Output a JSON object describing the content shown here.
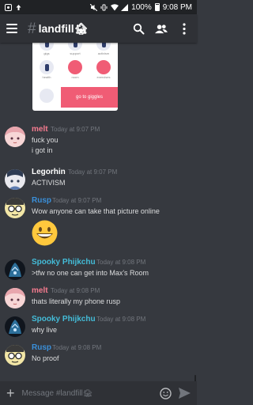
{
  "status_bar": {
    "battery": "100%",
    "time": "9:08 PM"
  },
  "header": {
    "hash": "#",
    "channel": "landfill",
    "channel_emoji": "🏚"
  },
  "attachment": {
    "labels": [
      "gigs",
      "support",
      "activism",
      "health",
      "room",
      "exercises"
    ],
    "button_label": "go to giggles"
  },
  "messages": [
    {
      "author": "melt",
      "color": "#f47b8f",
      "time": "Today at 9:07 PM",
      "lines": [
        "fuck you",
        "i got in"
      ],
      "avatar": "girl-avatar"
    },
    {
      "author": "Legorhin",
      "color": "#ffffff",
      "time": "Today at 9:07 PM",
      "lines": [
        "ACTIVISM"
      ],
      "avatar": "anime-avatar"
    },
    {
      "author": "Rusp",
      "color": "#3a8fd9",
      "time": "Today at 9:07 PM",
      "lines": [
        "Wow anyone can take that picture online"
      ],
      "avatar": "glasses-avatar",
      "emoji": "😄"
    },
    {
      "author": "Spooky Phijkchu",
      "color": "#44bcd8",
      "time": "Today at 9:08 PM",
      "lines": [
        ">tfw no one can get into Max's Room"
      ],
      "avatar": "dark-avatar"
    },
    {
      "author": "melt",
      "color": "#f47b8f",
      "time": "Today at 9:08 PM",
      "lines": [
        "thats literally my phone rusp"
      ],
      "avatar": "girl-avatar"
    },
    {
      "author": "Spooky Phijkchu",
      "color": "#44bcd8",
      "time": "Today at 9:08 PM",
      "lines": [
        "why live"
      ],
      "avatar": "dark-avatar"
    },
    {
      "author": "Rusp",
      "color": "#3a8fd9",
      "time": "Today at 9:08 PM",
      "lines": [
        "No proof"
      ],
      "avatar": "glasses-avatar"
    }
  ],
  "composer": {
    "placeholder": "Message #landfill🏚"
  }
}
